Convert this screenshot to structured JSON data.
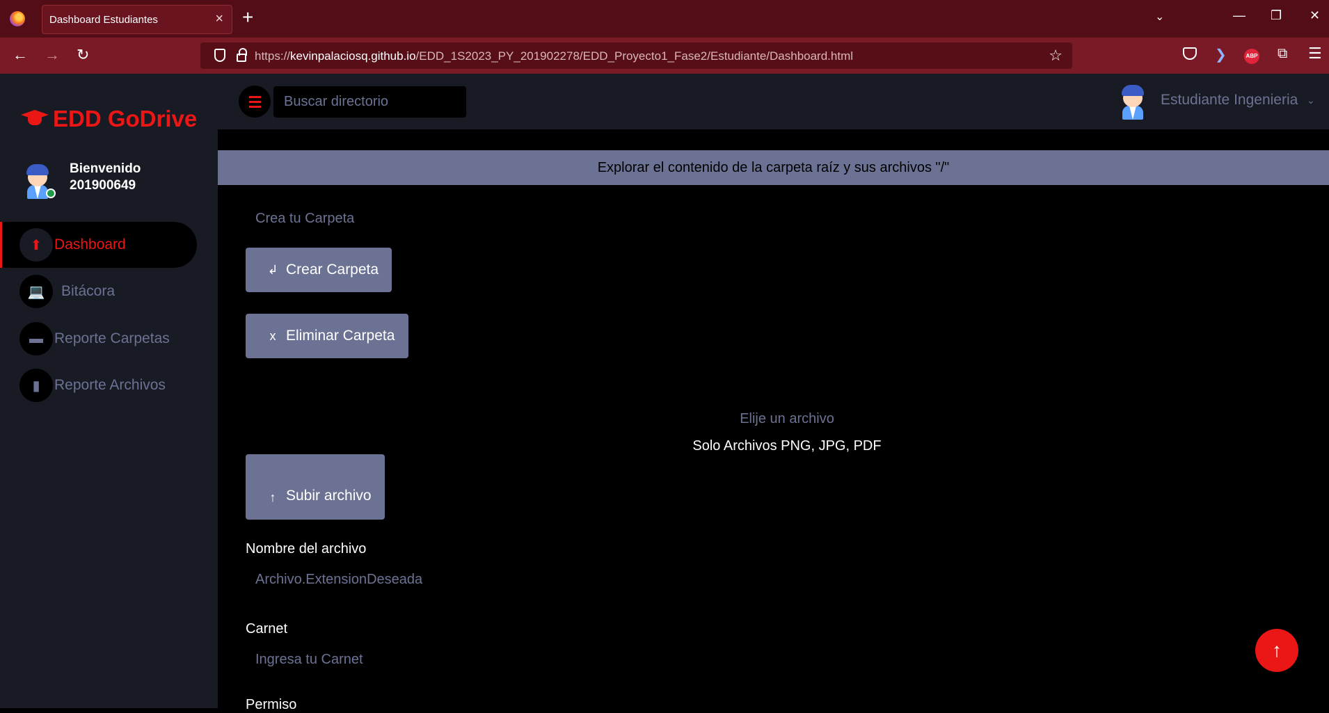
{
  "browser": {
    "tab_title": "Dashboard Estudiantes",
    "tab_close": "×",
    "new_tab": "+",
    "url_prefix": "https://",
    "url_host": "kevinpalaciosq.github.io",
    "url_path": "/EDD_1S2023_PY_201902278/EDD_Proyecto1_Fase2/Estudiante/Dashboard.html"
  },
  "sidebar": {
    "brand": "EDD GoDrive",
    "welcome_line1": "Bienvenido",
    "welcome_line2": "201900649",
    "items": [
      {
        "label": "Dashboard",
        "icon": "upload-icon",
        "glyph": "⬆",
        "active": true
      },
      {
        "label": "Bitácora",
        "icon": "laptop-icon",
        "glyph": "💻",
        "active": false
      },
      {
        "label": "Reporte Carpetas",
        "icon": "folder-icon",
        "glyph": "▬",
        "active": false
      },
      {
        "label": "Reporte Archivos",
        "icon": "file-icon",
        "glyph": "▮",
        "active": false
      }
    ]
  },
  "topbar": {
    "search_placeholder": "Buscar directorio",
    "user_name": "Estudiante Ingenieria"
  },
  "main": {
    "banner": "Explorar el contenido de la carpeta raíz y sus archivos \"/\"",
    "folder_placeholder": "Crea tu Carpeta",
    "create_folder_glyph": "↲",
    "create_folder_label": "Crear Carpeta",
    "delete_folder_glyph": "x",
    "delete_folder_label": "Eliminar Carpeta",
    "choose_file": "Elije un archivo",
    "file_types": "Solo Archivos PNG, JPG, PDF",
    "upload_glyph": "↑",
    "upload_label": "Subir archivo",
    "filename_label": "Nombre del archivo",
    "filename_placeholder": "Archivo.ExtensionDeseada",
    "carnet_label": "Carnet",
    "carnet_placeholder": "Ingresa tu Carnet",
    "permiso_label": "Permiso"
  },
  "colors": {
    "accent": "#eb1616",
    "muted": "#6c7293",
    "sidebar_bg": "#181b23",
    "browser_tabbar": "#520d16",
    "browser_navbar": "#7a1a26"
  }
}
